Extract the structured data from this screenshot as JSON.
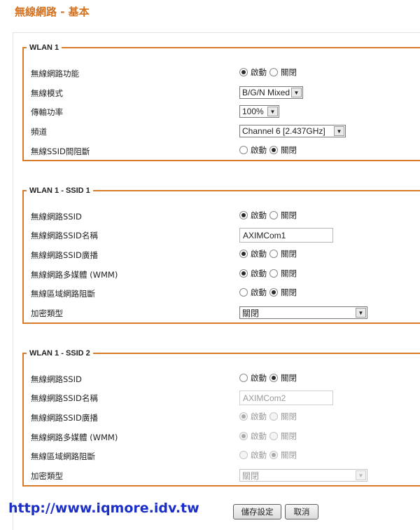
{
  "page": {
    "title": "無線網路 - 基本"
  },
  "wlan1": {
    "legend": "WLAN 1",
    "rows": {
      "wifi": {
        "label": "無線網路功能",
        "on": "啟動",
        "off": "關閉",
        "selected": "on"
      },
      "mode": {
        "label": "無線模式",
        "value": "B/G/N Mixed"
      },
      "power": {
        "label": "傳輸功率",
        "value": "100%"
      },
      "channel": {
        "label": "頻道",
        "value": "Channel 6 [2.437GHz]"
      },
      "isolation": {
        "label": "無線SSID間阻斷",
        "on": "啟動",
        "off": "關閉",
        "selected": "off"
      }
    }
  },
  "ssid1": {
    "legend": "WLAN 1 - SSID 1",
    "rows": {
      "ssid": {
        "label": "無線網路SSID",
        "on": "啟動",
        "off": "關閉",
        "selected": "on"
      },
      "name": {
        "label": "無線網路SSID名稱",
        "value": "AXIMCom1"
      },
      "broadcast": {
        "label": "無線網路SSID廣播",
        "on": "啟動",
        "off": "關閉",
        "selected": "on"
      },
      "wmm": {
        "label": "無線網路多媒體 (WMM)",
        "on": "啟動",
        "off": "關閉",
        "selected": "on"
      },
      "lan_block": {
        "label": "無線區域網路阻斷",
        "on": "啟動",
        "off": "關閉",
        "selected": "off"
      },
      "encryption": {
        "label": "加密類型",
        "value": "關閉"
      }
    }
  },
  "ssid2": {
    "legend": "WLAN 1 - SSID 2",
    "rows": {
      "ssid": {
        "label": "無線網路SSID",
        "on": "啟動",
        "off": "關閉",
        "selected": "off"
      },
      "name": {
        "label": "無線網路SSID名稱",
        "value": "AXIMCom2"
      },
      "broadcast": {
        "label": "無線網路SSID廣播",
        "on": "啟動",
        "off": "關閉",
        "selected": "on"
      },
      "wmm": {
        "label": "無線網路多媒體 (WMM)",
        "on": "啟動",
        "off": "關閉",
        "selected": "on"
      },
      "lan_block": {
        "label": "無線區域網路阻斷",
        "on": "啟動",
        "off": "關閉",
        "selected": "off"
      },
      "encryption": {
        "label": "加密類型",
        "value": "關閉"
      }
    }
  },
  "footer": {
    "url": "http://www.iqmore.idv.tw",
    "save_label": "儲存設定",
    "cancel_label": "取消"
  },
  "colors": {
    "accent": "#d97a2a",
    "title": "#d4711f",
    "url": "#1c2ec8"
  }
}
